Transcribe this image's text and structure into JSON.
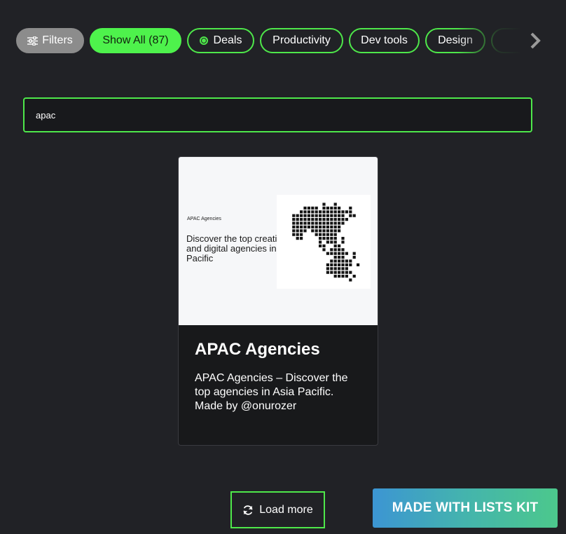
{
  "filters": {
    "filters_label": "Filters",
    "show_all_label": "Show All (87)",
    "deals_label": "Deals",
    "productivity_label": "Productivity",
    "dev_tools_label": "Dev tools",
    "design_label": "Design",
    "next_icon": "chevron-right-icon"
  },
  "search": {
    "value": "apac"
  },
  "card": {
    "thumb_small": "APAC Agencies",
    "thumb_headline": "Discover the top creative and digital agencies in Asia Pacific",
    "title": "APAC Agencies",
    "description": "APAC Agencies – Discover the top agencies in Asia Pacific. Made by @onurozer"
  },
  "load_more": {
    "label": "Load more",
    "icon": "refresh-icon"
  },
  "badge": {
    "label": "MADE WITH LISTS KIT"
  },
  "colors": {
    "accent": "#4ee84a",
    "background": "#212226",
    "card": "#18191b"
  }
}
